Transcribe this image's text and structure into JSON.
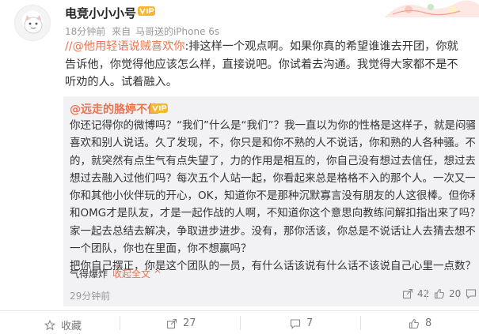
{
  "post": {
    "username": "电竞小小小号",
    "time": "18分钟前",
    "source_prefix": "来自",
    "source": "马哥送的iPhone 6s",
    "slashes": "//",
    "mention": "@他用轻语说贼喜欢你",
    "body_lines": [
      ":排这样一个观点啊。如果你真的希望谁谁去开团，你就",
      "告诉他，你觉得他应该怎么样，直接说吧。你试着去沟通。我觉得大家都不是不",
      "听劝的人。试着融入。"
    ]
  },
  "repost": {
    "username": "@远走的胳婷不住",
    "lines": [
      "你还记得你的微博吗？“我们”什么是“我们”？我一直以为你的性格是这样子，就是闷骚，不太",
      "喜欢和别人说话。久了发现，不，你只是和你不熟的人不说话，你和熟的人各种骚。不知怎么",
      "的，就突然有点生气有点失望了，力的作用是相互的，你自己没有想过去信任，想过去沟通，",
      "想过去融入过他们吗？每次五个人站一起，你看起来总是格格不入的那个人。一次又一次知道",
      "你和其他小伙伴玩的开心，OK，知道你不是那种沉默寡言没有朋友的人这很棒。但你和他们你",
      "和OMG才是队友，才是一起作战的人啊，不知道你这个意思向教练问解扣指出来了吗？有，大",
      "家一起去总结去解决，争取进步进步。没有，那你活该，你总是不说话让人去猜去想不累吗，",
      "一个团队，你也在里面，你不想赢吗？",
      "把你自己摆正，你是这个团队的一员，有什么话该说有什么话不该说自己心里一点数？"
    ],
    "footer_text": "气得爆炸",
    "collapse_label": "收起全文",
    "collapse_chevron": "^",
    "time": "29分钟前",
    "share_count": "42",
    "comment_count": "7",
    "like_count": "20"
  },
  "actions": {
    "favorite_label": "收藏",
    "share_count": "27",
    "comment_count": "7",
    "like_count": "8"
  },
  "colors": {
    "accent": "#eb7350",
    "meta": "#999999",
    "repost_bg": "#f2f2f5"
  },
  "icons": {
    "avatar": "avatar-art",
    "vip": "vip-badge-icon",
    "share": "share-icon",
    "comment": "comment-icon",
    "like": "like-icon",
    "favorite": "star-icon"
  }
}
